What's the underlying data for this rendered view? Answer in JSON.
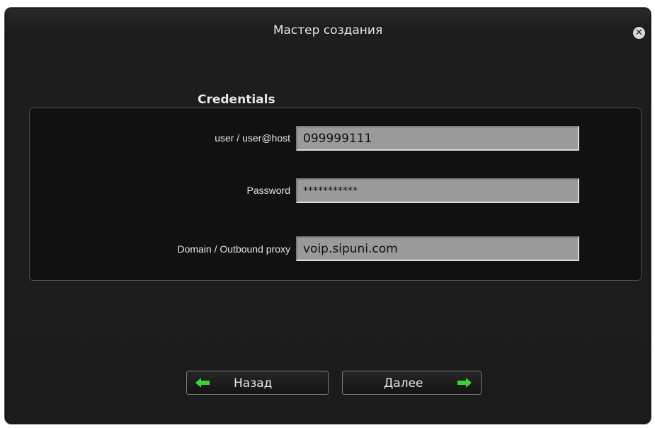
{
  "window": {
    "title": "Мастер создания",
    "close_icon": "close-icon"
  },
  "section": {
    "title": "Credentials"
  },
  "fields": [
    {
      "label": "user / user@host",
      "value": "099999111"
    },
    {
      "label": "Password",
      "value": "***********"
    },
    {
      "label": "Domain / Outbound proxy",
      "value": "voip.sipuni.com"
    }
  ],
  "buttons": {
    "back_label": "Назад",
    "next_label": "Далее",
    "back_icon": "arrow-left-icon",
    "next_icon": "arrow-right-icon",
    "arrow_color": "#3dd13d"
  }
}
